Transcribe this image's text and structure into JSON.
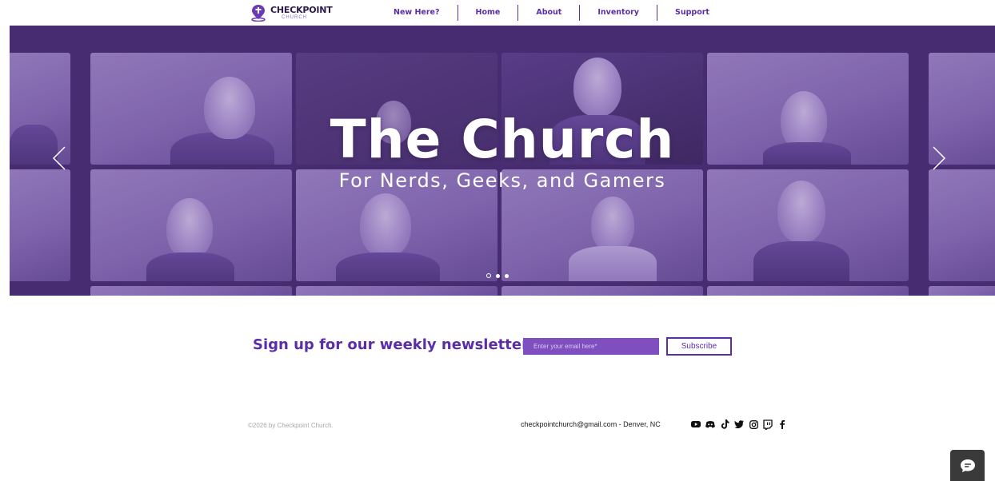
{
  "header": {
    "logo_title": "CHECKPOINT",
    "logo_sub": "CHURCH",
    "nav": [
      {
        "label": "New Here?"
      },
      {
        "label": "Home"
      },
      {
        "label": "About"
      },
      {
        "label": "Inventory"
      },
      {
        "label": "Support"
      }
    ]
  },
  "hero": {
    "title": "The Church",
    "subtitle": "For Nerds, Geeks, and Gamers",
    "slide_count": 3,
    "active_slide": 1
  },
  "newsletter": {
    "title": "Sign up for our weekly newsletter.",
    "email_placeholder": "Enter your email here*",
    "subscribe_label": "Subscribe"
  },
  "footer": {
    "copyright": "©2026 by Checkpoint Church.",
    "contact": "checkpointchurch@gmail.com - Denver, NC",
    "socials": [
      "youtube-icon",
      "discord-icon",
      "tiktok-icon",
      "twitter-icon",
      "instagram-icon",
      "twitch-icon",
      "facebook-icon"
    ]
  },
  "colors": {
    "brand_purple": "#5a2ea6",
    "hero_bg": "#4b2f76",
    "input_bg": "#7f4fc0"
  }
}
